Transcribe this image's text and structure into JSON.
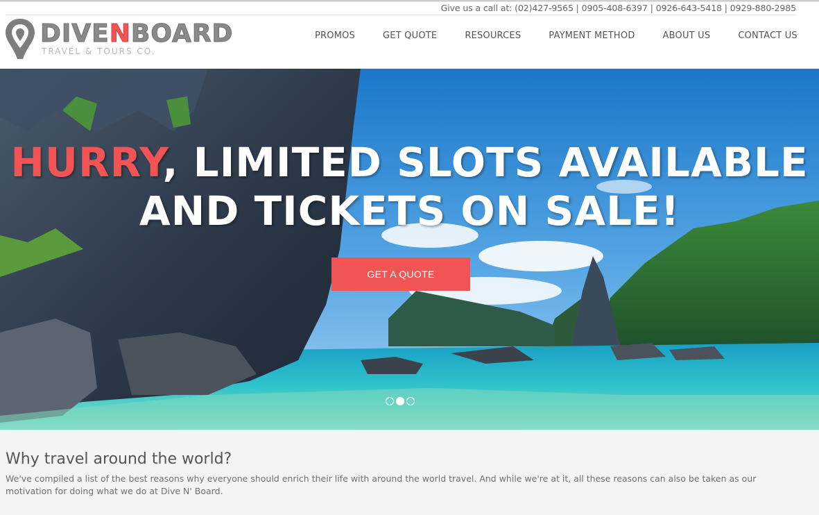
{
  "header": {
    "call_text": "Give us a call at: (02)427-9565 | 0905-408-6397 | 0926-643-5418 | 0929-880-2985",
    "logo": {
      "part1": "DIVE",
      "part2": "N",
      "part3": "BOARD",
      "tagline": "TRAVEL & TOURS CO."
    },
    "nav": [
      "PROMOS",
      "GET QUOTE",
      "RESOURCES",
      "PAYMENT METHOD",
      "ABOUT US",
      "CONTACT US"
    ]
  },
  "hero": {
    "headline_highlight": "HURRY",
    "headline_rest_line1": ", LIMITED SLOTS AVAILABLE",
    "headline_line2": "AND TICKETS ON SALE!",
    "cta_label": "GET A QUOTE",
    "slides_count": 3,
    "active_slide": 2
  },
  "why": {
    "title": "Why travel around the world?",
    "body": "We've compiled a list of the best reasons why everyone should enrich their life with around the world travel. And while we're at it, all these reasons can also be taken as our motivation for doing what we do at Dive N' Board."
  },
  "colors": {
    "accent": "#f05454",
    "logo_gray": "#8a8a8a",
    "section_bg": "#f4f4f4"
  }
}
